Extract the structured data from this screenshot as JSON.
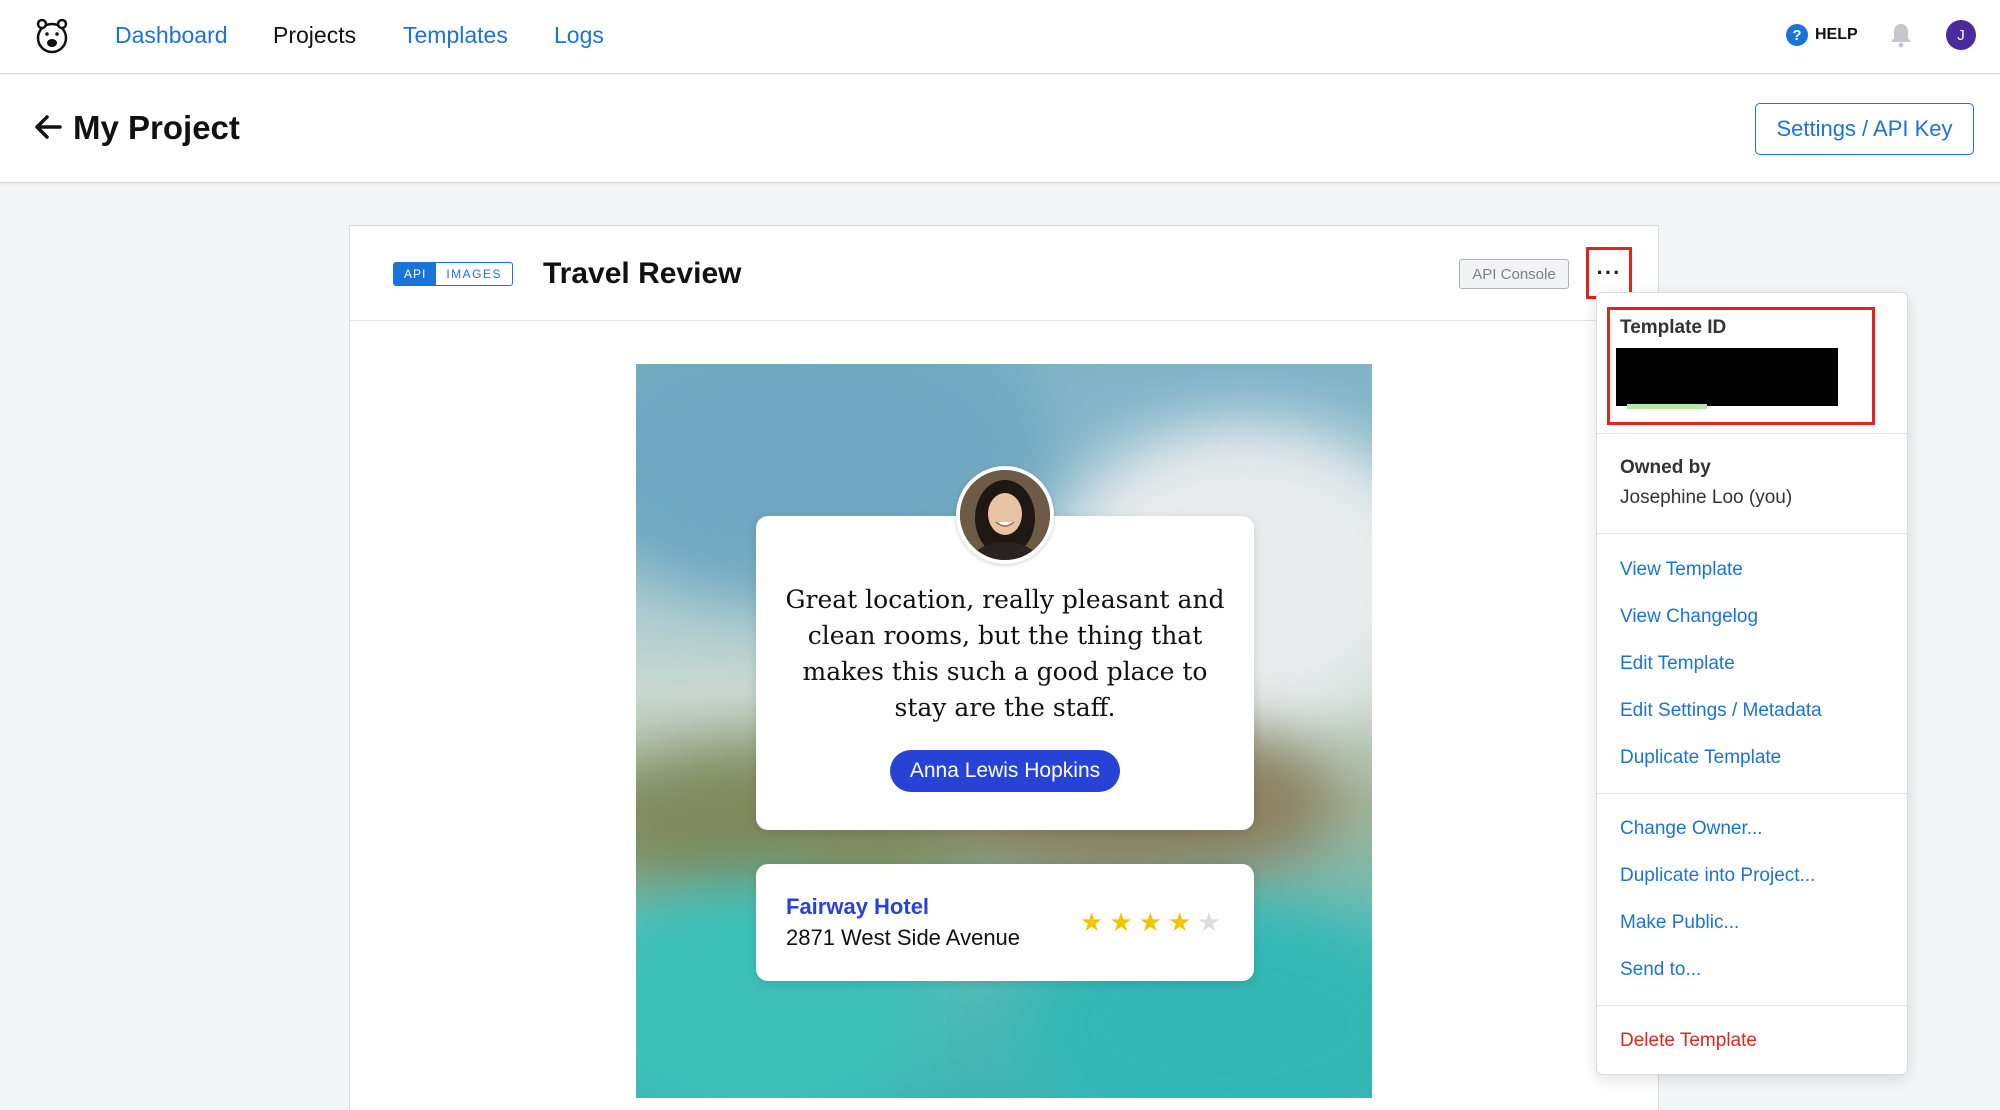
{
  "nav": {
    "logo": "bear-logo",
    "links": [
      "Dashboard",
      "Projects",
      "Templates",
      "Logs"
    ],
    "active": "Projects",
    "help_label": "HELP",
    "help_icon": "?",
    "avatar_initial": "J"
  },
  "subheader": {
    "title": "My Project",
    "settings_label": "Settings / API Key"
  },
  "card": {
    "badge_api": "API",
    "badge_images": "IMAGES",
    "title": "Travel Review",
    "api_console_label": "API Console",
    "more_label": "···"
  },
  "preview": {
    "quote": "Great location, really pleasant and clean rooms, but the thing that makes this such a good place to stay are the staff.",
    "author": "Anna Lewis Hopkins",
    "hotel_name": "Fairway Hotel",
    "hotel_address": "2871 West Side Avenue",
    "rating": 4,
    "rating_max": 5
  },
  "menu": {
    "template_id_label": "Template ID",
    "owned_by_label": "Owned by",
    "owned_by_value": "Josephine Loo (you)",
    "group1": [
      "View Template",
      "View Changelog",
      "Edit Template",
      "Edit Settings / Metadata",
      "Duplicate Template"
    ],
    "group2": [
      "Change Owner...",
      "Duplicate into Project...",
      "Make Public...",
      "Send to..."
    ],
    "delete_label": "Delete Template"
  },
  "colors": {
    "link": "#1a73d9",
    "highlight": "#e0251f",
    "brand_blue": "#2743d6",
    "star": "#f5c400"
  }
}
